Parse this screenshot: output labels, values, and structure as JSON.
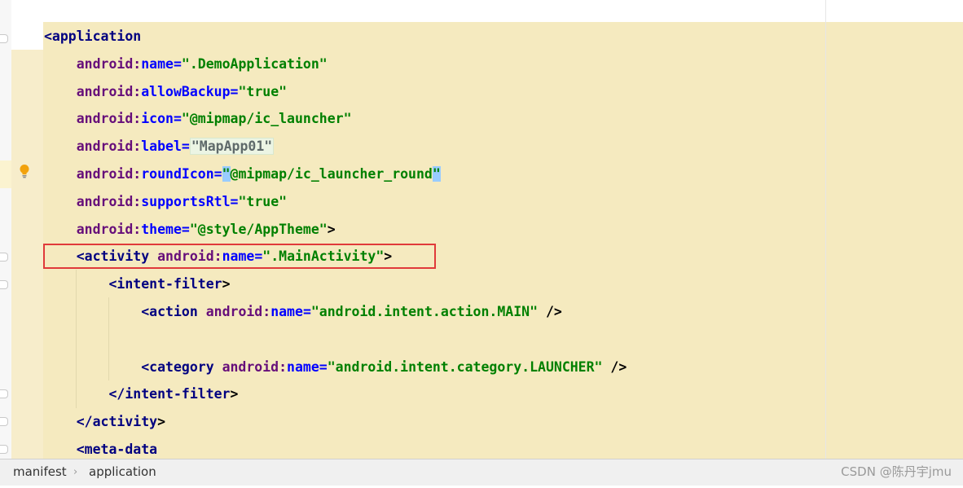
{
  "editor": {
    "lines": [
      {
        "indent": "",
        "tokens": [
          [
            "tag",
            "<application"
          ]
        ]
      },
      {
        "indent": "    ",
        "tokens": [
          [
            "ns",
            "android:"
          ],
          [
            "attr",
            "name"
          ],
          [
            "eq",
            "="
          ],
          [
            "val",
            "\".DemoApplication\""
          ]
        ]
      },
      {
        "indent": "    ",
        "tokens": [
          [
            "ns",
            "android:"
          ],
          [
            "attr",
            "allowBackup"
          ],
          [
            "eq",
            "="
          ],
          [
            "val",
            "\"true\""
          ]
        ]
      },
      {
        "indent": "    ",
        "tokens": [
          [
            "ns",
            "android:"
          ],
          [
            "attr",
            "icon"
          ],
          [
            "eq",
            "="
          ],
          [
            "val",
            "\"@mipmap/ic_launcher\""
          ]
        ]
      },
      {
        "indent": "    ",
        "tokens": [
          [
            "ns",
            "android:"
          ],
          [
            "attr",
            "label"
          ],
          [
            "eq",
            "="
          ],
          [
            "valbox",
            "\"MapApp01\""
          ]
        ]
      },
      {
        "indent": "    ",
        "tokens": [
          [
            "ns",
            "android:"
          ],
          [
            "attr",
            "roundIcon"
          ],
          [
            "eq",
            "="
          ],
          [
            "quote",
            "\""
          ],
          [
            "val",
            "@mipmap/ic_launcher_round"
          ],
          [
            "quote",
            "\""
          ]
        ]
      },
      {
        "indent": "    ",
        "tokens": [
          [
            "ns",
            "android:"
          ],
          [
            "attr",
            "supportsRtl"
          ],
          [
            "eq",
            "="
          ],
          [
            "val",
            "\"true\""
          ]
        ]
      },
      {
        "indent": "    ",
        "tokens": [
          [
            "ns",
            "android:"
          ],
          [
            "attr",
            "theme"
          ],
          [
            "eq",
            "="
          ],
          [
            "val",
            "\"@style/AppTheme\""
          ],
          [
            "punct",
            ">"
          ]
        ]
      },
      {
        "indent": "    ",
        "tokens": [
          [
            "tag",
            "<activity "
          ],
          [
            "ns",
            "android:"
          ],
          [
            "attr",
            "name"
          ],
          [
            "eq",
            "="
          ],
          [
            "val",
            "\".MainActivity\""
          ],
          [
            "punct",
            ">"
          ]
        ]
      },
      {
        "indent": "        ",
        "tokens": [
          [
            "tag",
            "<intent-filter"
          ],
          [
            "punct",
            ">"
          ]
        ]
      },
      {
        "indent": "            ",
        "tokens": [
          [
            "tag",
            "<action "
          ],
          [
            "ns",
            "android:"
          ],
          [
            "attr",
            "name"
          ],
          [
            "eq",
            "="
          ],
          [
            "val",
            "\"android.intent.action.MAIN\""
          ],
          [
            "punct",
            " />"
          ]
        ]
      },
      {
        "indent": "",
        "tokens": []
      },
      {
        "indent": "            ",
        "tokens": [
          [
            "tag",
            "<category "
          ],
          [
            "ns",
            "android:"
          ],
          [
            "attr",
            "name"
          ],
          [
            "eq",
            "="
          ],
          [
            "val",
            "\"android.intent.category.LAUNCHER\""
          ],
          [
            "punct",
            " />"
          ]
        ]
      },
      {
        "indent": "        ",
        "tokens": [
          [
            "tag",
            "</intent-filter"
          ],
          [
            "punct",
            ">"
          ]
        ]
      },
      {
        "indent": "    ",
        "tokens": [
          [
            "tag",
            "</activity"
          ],
          [
            "punct",
            ">"
          ]
        ]
      },
      {
        "indent": "    ",
        "tokens": [
          [
            "tag",
            "<meta-data"
          ]
        ]
      }
    ]
  },
  "gutter": {
    "intention_icon": "lightbulb-icon"
  },
  "breadcrumbs": {
    "items": [
      "manifest",
      "application"
    ],
    "separator": "›"
  },
  "watermark": "CSDN @陈丹宇jmu",
  "colors": {
    "tag": "#000080",
    "namespace": "#660e7a",
    "attribute": "#0000ff",
    "value": "#008000",
    "highlight": "#f5eabf",
    "annotation_box": "#e03a3a"
  }
}
